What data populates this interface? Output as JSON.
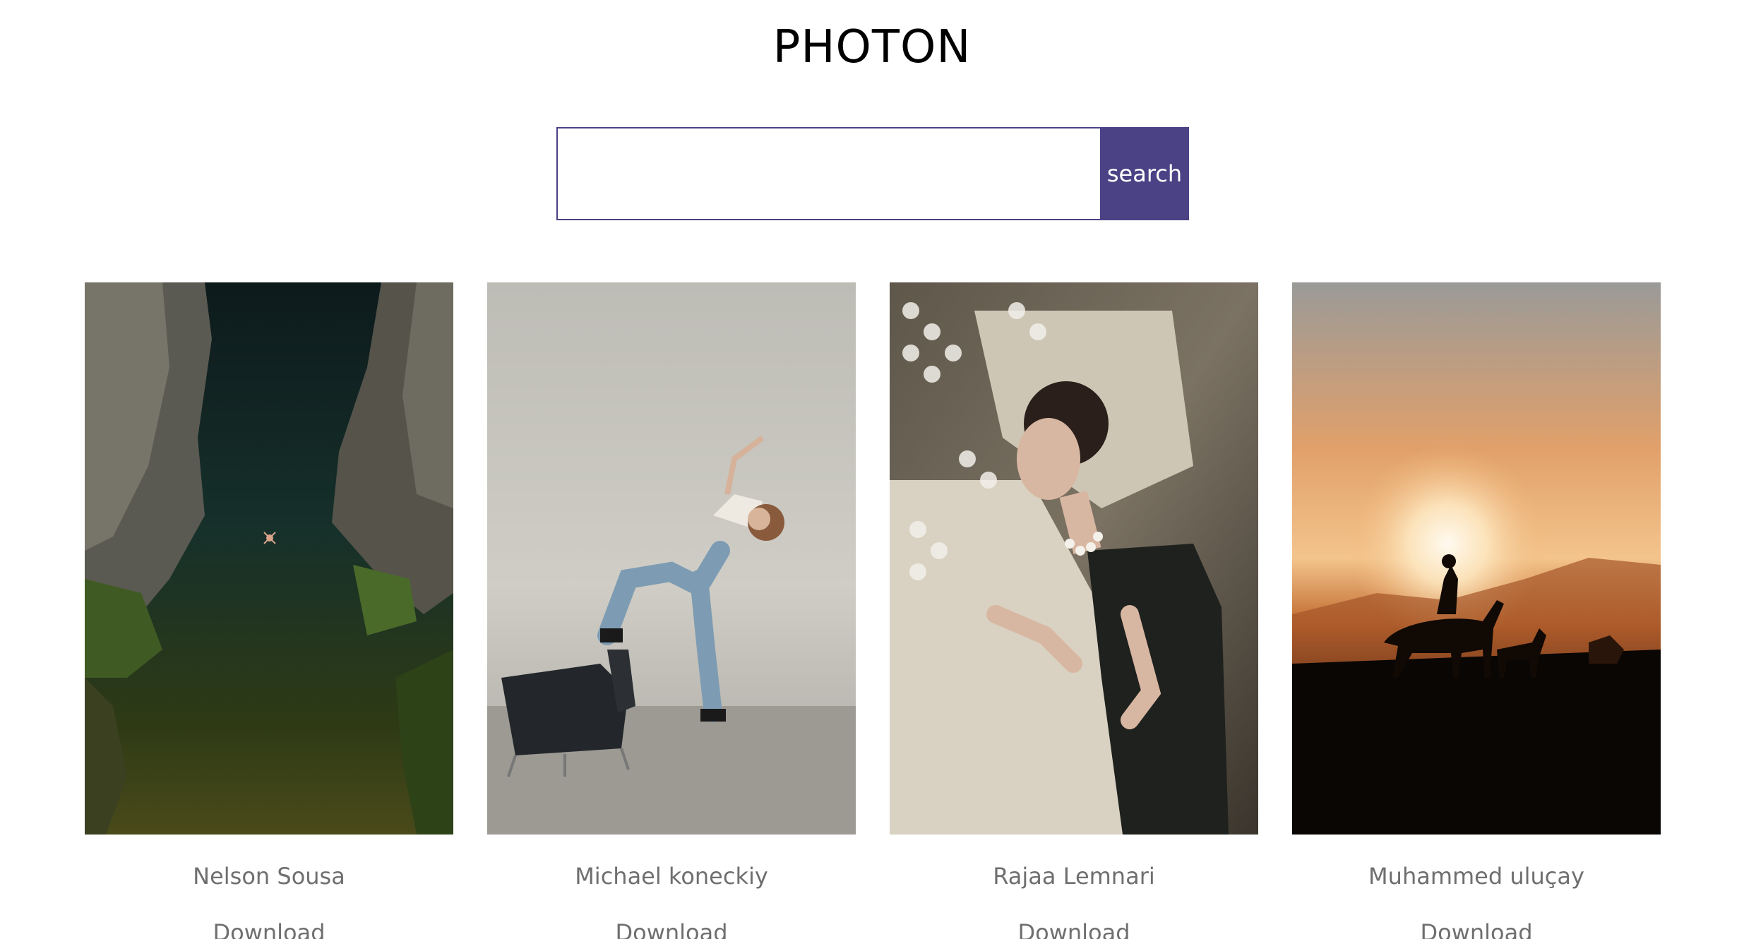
{
  "header": {
    "title": "PHOTON"
  },
  "search": {
    "value": "",
    "placeholder": "",
    "button_label": "search"
  },
  "colors": {
    "accent": "#4b4285",
    "text_muted": "#6f6f6f"
  },
  "photos": [
    {
      "author": "Nelson Sousa",
      "download_label": "Download",
      "subject": "aerial river canyon swimmer"
    },
    {
      "author": "Michael koneckiy",
      "download_label": "Download",
      "subject": "dancer with armchair"
    },
    {
      "author": "Rajaa Lemnari",
      "download_label": "Download",
      "subject": "woman on sofa with pearls"
    },
    {
      "author": "Muhammed uluçay",
      "download_label": "Download",
      "subject": "rider silhouette at sunset"
    }
  ]
}
